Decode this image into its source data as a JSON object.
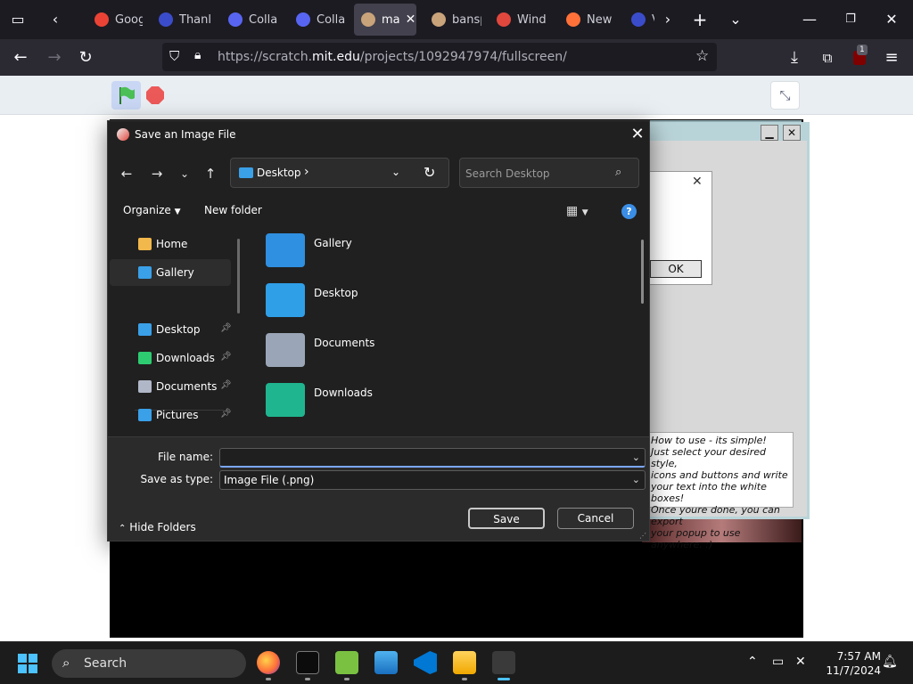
{
  "browser": {
    "tabs": [
      {
        "label": "Goog",
        "color": "#ea4335"
      },
      {
        "label": "Thanl",
        "color": "#3b4cca"
      },
      {
        "label": "Colla",
        "color": "#5865f2"
      },
      {
        "label": "Colla",
        "color": "#5865f2"
      },
      {
        "label": "ma",
        "color": "#c9a37a",
        "active": true
      },
      {
        "label": "bansp",
        "color": "#c9a37a"
      },
      {
        "label": "Wind",
        "color": "#e0473d"
      },
      {
        "label": "New",
        "color": "#ff7139"
      },
      {
        "label": "V",
        "color": "#3b4cca"
      }
    ],
    "url_prefix": "https://scratch.",
    "url_domain": "mit.edu",
    "url_path": "/projects/1092947974/fullscreen/",
    "extension_badge": "1"
  },
  "background_window": {
    "ok_label": "OK",
    "howto_lines": [
      "How to use - its simple!",
      "Just select your desired style,",
      "icons and buttons and write",
      "your text into the white boxes!",
      "Once youre done, you can export",
      "your popup to use anywhere. :)"
    ]
  },
  "dialog": {
    "title": "Save an Image File",
    "address": "Desktop",
    "search_placeholder": "Search Desktop",
    "organize_label": "Organize",
    "new_folder_label": "New folder",
    "nav_items": [
      {
        "label": "Home",
        "color": "#f2b84b"
      },
      {
        "label": "Gallery",
        "color": "#3aa0e8",
        "selected": true
      },
      {
        "label": "Desktop",
        "color": "#3aa0e8",
        "pinned": true
      },
      {
        "label": "Downloads",
        "color": "#2ecc71",
        "pinned": true
      },
      {
        "label": "Documents",
        "color": "#b0b8c8",
        "pinned": true
      },
      {
        "label": "Pictures",
        "color": "#3aa0e8",
        "pinned": true
      }
    ],
    "folders": [
      {
        "label": "Gallery",
        "color": "#2f8fe0"
      },
      {
        "label": "Desktop",
        "color": "#2f9fe8"
      },
      {
        "label": "Documents",
        "color": "#9aa6b8"
      },
      {
        "label": "Downloads",
        "color": "#1fb58f"
      }
    ],
    "file_name_label": "File name:",
    "file_name_value": "",
    "save_type_label": "Save as type:",
    "save_type_value": "Image File (.png)",
    "hide_folders_label": "Hide Folders",
    "save_label": "Save",
    "cancel_label": "Cancel"
  },
  "taskbar": {
    "search_label": "Search",
    "time": "7:57 AM",
    "date": "11/7/2024"
  }
}
